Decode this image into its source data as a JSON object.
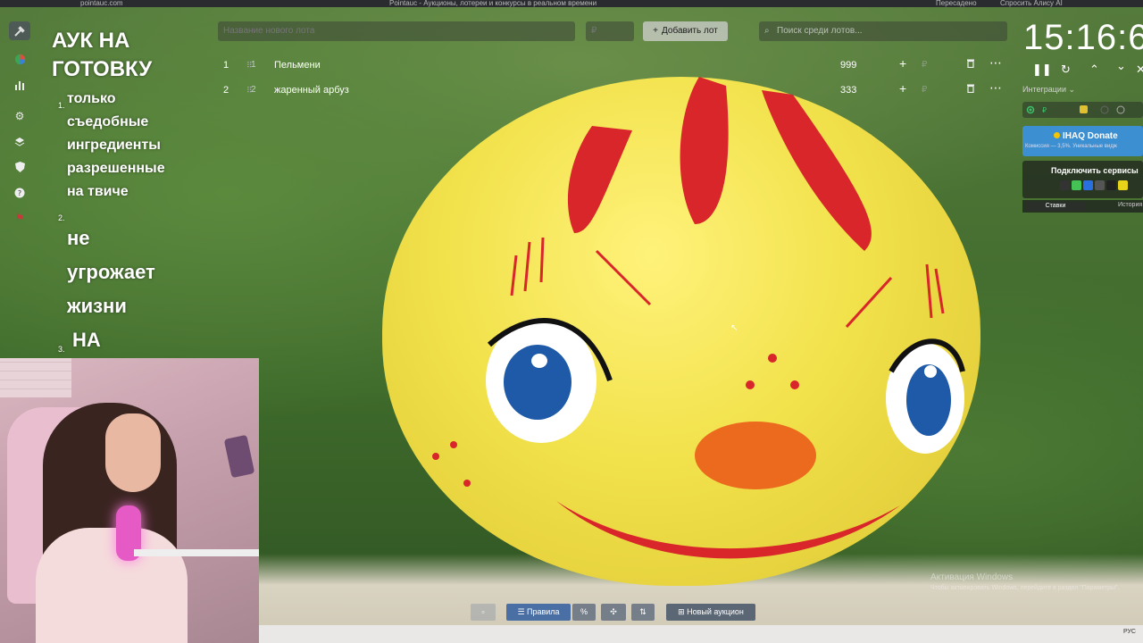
{
  "browser": {
    "url": "pointauc.com",
    "tab_title": "Pointauc - Аукционы, лотереи и конкурсы в реальном времени",
    "right_tabs": [
      "Пересадено",
      "Спросить Алису AI"
    ]
  },
  "sidebar": {
    "icons": [
      "hammer-logo",
      "pie-chart-icon",
      "bar-chart-icon",
      "gear-icon",
      "layers-icon",
      "shield-icon",
      "help-icon",
      "flag-icon"
    ]
  },
  "rules_overlay": {
    "title": "АУК НА ГОТОВКУ",
    "items": [
      {
        "num": "1.",
        "text": "только съедобные ингредиенты разрешенные на твиче"
      },
      {
        "num": "2.",
        "text": "не угрожает жизни"
      },
      {
        "num": "3.",
        "text": "НА"
      }
    ]
  },
  "auction": {
    "new_lot_placeholder": "Название нового лота",
    "amount_placeholder": "₽",
    "add_button": "Добавить лот",
    "search_placeholder": "Поиск среди лотов...",
    "lots": [
      {
        "index": "1",
        "id": "1",
        "name": "Пельмени",
        "amount": "999"
      },
      {
        "index": "2",
        "id": "2",
        "name": "жаренный арбуз",
        "amount": "333"
      }
    ]
  },
  "timer": {
    "display": "15:16:6",
    "controls": [
      "pause-icon",
      "restart-icon",
      "chevron-up-icon",
      "chevron-down-icon",
      "close-icon"
    ]
  },
  "integrations": {
    "label": "Интеграции",
    "donate_title": "IHAQ Donate",
    "donate_subtitle": "Комиссия — 3,5%. Уникальные видж",
    "connect_title": "Подключить сервисы",
    "tabs": [
      "Ставки",
      "История"
    ]
  },
  "watermark": {
    "line1": "Активация Windows",
    "line2": "Чтобы активировать Windows, перейдите в раздел \"Параметры\"."
  },
  "bottom_toolbar": {
    "rules": "Правила",
    "new_auction": "Новый аукцион"
  },
  "taskbar": {
    "tray": "РУС"
  },
  "colors": {
    "accent_blue": "#3c8fd1",
    "primary_button": "#4a6fa5",
    "background_green": "#3b5e2b"
  }
}
